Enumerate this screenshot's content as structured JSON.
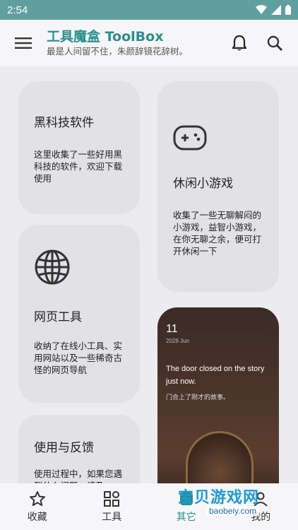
{
  "status_bar": {
    "time": "2:54"
  },
  "app_bar": {
    "title": "工具魔盒 ToolBox",
    "subtitle": "最是人间留不住，朱颜辞镜花辞树。"
  },
  "cards": [
    {
      "title": "黑科技软件",
      "description": "这里收集了一些好用黑科技的软件，欢迎下载使用"
    },
    {
      "title": "休闲小游戏",
      "description": "收集了一些无聊解闷的小游戏，益智小游戏，在你无聊之余，便可打开休闲一下"
    },
    {
      "title": "网页工具",
      "description": "收纳了在线小工具、实用网站以及一些稀奇古怪的网页导航"
    },
    {
      "title": "使用与反馈",
      "description": "使用过程中，如果您遇到什么问题，请及"
    }
  ],
  "quote_card": {
    "day": "11",
    "date": "2028 Jun",
    "quote_en": "The door closed on the story just now.",
    "quote_cn": "门合上了刚才的故事。"
  },
  "bottom_nav": [
    {
      "label": "收藏",
      "icon": "star-icon"
    },
    {
      "label": "工具",
      "icon": "grid-icon"
    },
    {
      "label": "其它",
      "icon": "other-icon"
    },
    {
      "label": "我的",
      "icon": "person-icon"
    }
  ],
  "watermark": {
    "text": "宝贝游戏网",
    "url": "baobeiy.com"
  },
  "colors": {
    "accent": "#2a8f8f",
    "status_bar": "#5f9fa0",
    "card": "#e2e1e6",
    "background": "#ecebf0"
  }
}
